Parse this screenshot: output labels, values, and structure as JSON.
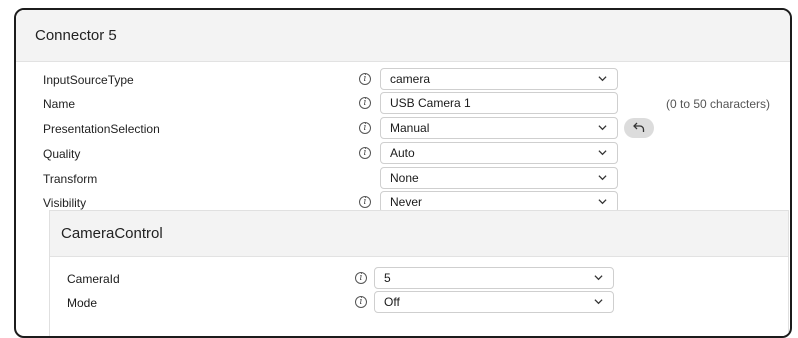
{
  "panel": {
    "title": "Connector 5",
    "info_glyph": "i",
    "rows": [
      {
        "label": "InputSourceType",
        "value": "camera",
        "type": "select",
        "info": true
      },
      {
        "label": "Name",
        "value": "USB Camera 1",
        "type": "text",
        "info": true,
        "hint": "(0 to 50 characters)"
      },
      {
        "label": "PresentationSelection",
        "value": "Manual",
        "type": "select",
        "info": true,
        "revert_icon": "undo-icon"
      },
      {
        "label": "Quality",
        "value": "Auto",
        "type": "select",
        "info": true
      },
      {
        "label": "Transform",
        "value": "None",
        "type": "select",
        "info": false
      },
      {
        "label": "Visibility",
        "value": "Never",
        "type": "select",
        "info": true
      }
    ]
  },
  "camera_control": {
    "title": "CameraControl",
    "rows": [
      {
        "label": "CameraId",
        "value": "5",
        "type": "select",
        "info": true
      },
      {
        "label": "Mode",
        "value": "Off",
        "type": "select",
        "info": true
      }
    ]
  },
  "colors": {
    "header_bg": "#f3f3f3",
    "border": "#cfcfcf",
    "revert_button_bg": "#dcdcdc"
  }
}
